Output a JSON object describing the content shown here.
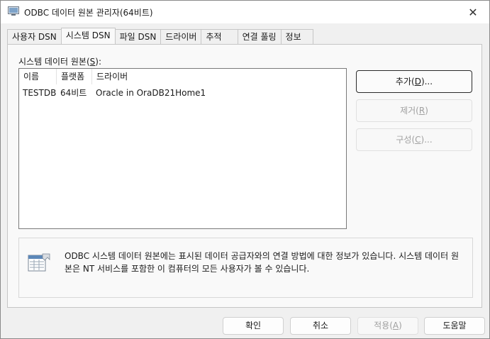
{
  "window": {
    "title": "ODBC 데이터 원본 관리자(64비트)",
    "close_glyph": "✕"
  },
  "tabs": [
    {
      "label": "사용자 DSN",
      "active": false
    },
    {
      "label": "시스템 DSN",
      "active": true
    },
    {
      "label": "파일 DSN",
      "active": false
    },
    {
      "label": "드라이버",
      "active": false
    },
    {
      "label": "추적",
      "active": false
    },
    {
      "label": "연결 풀링",
      "active": false
    },
    {
      "label": "정보",
      "active": false
    }
  ],
  "panel": {
    "group_label_pre": "시스템 데이터 원본(",
    "group_label_key": "S",
    "group_label_post": "):",
    "columns": [
      "이름",
      "플랫폼",
      "드라이버"
    ],
    "rows": [
      {
        "name": "TESTDB",
        "platform": "64비트",
        "driver": "Oracle in OraDB21Home1"
      }
    ],
    "buttons": {
      "add": {
        "pre": "추가(",
        "key": "D",
        "post": ")..."
      },
      "remove": {
        "pre": "제거(",
        "key": "R",
        "post": ")"
      },
      "configure": {
        "pre": "구성(",
        "key": "C",
        "post": ")..."
      }
    },
    "info_text": "ODBC 시스템 데이터 원본에는 표시된 데이터 공급자와의 연결 방법에 대한 정보가 있습니다. 시스템 데이터 원본은 NT 서비스를 포함한 이 컴퓨터의 모든 사용자가 볼 수 있습니다."
  },
  "footer": {
    "ok": "확인",
    "cancel": "취소",
    "apply_pre": "적용(",
    "apply_key": "A",
    "apply_post": ")",
    "help": "도움말"
  }
}
